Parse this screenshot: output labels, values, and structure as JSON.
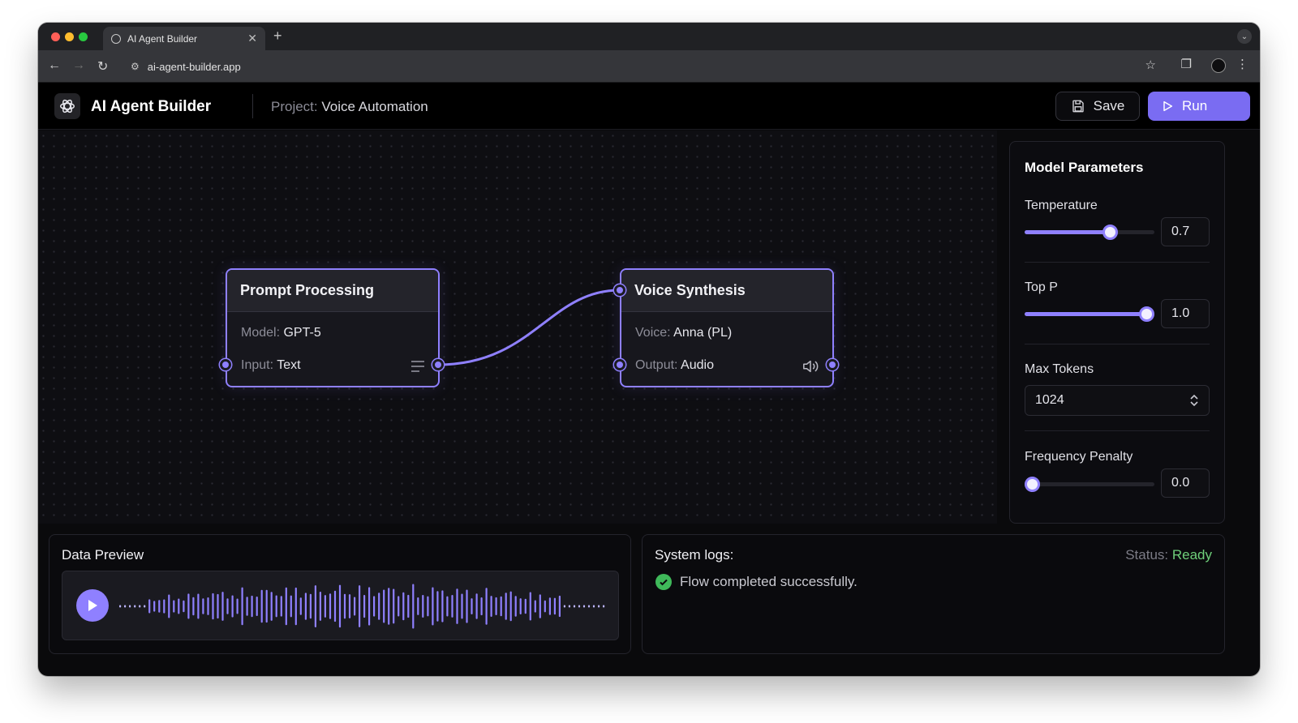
{
  "browser": {
    "tab_title": "AI Agent Builder",
    "url": "ai-agent-builder.app"
  },
  "header": {
    "app_title": "AI Agent Builder",
    "project_label": "Project:",
    "project_name": "Voice Automation",
    "save_label": "Save",
    "run_label": "Run"
  },
  "nodes": [
    {
      "title": "Prompt Processing",
      "rows": [
        {
          "label": "Model:",
          "value": "GPT-5"
        },
        {
          "label": "Input:",
          "value": "Text"
        }
      ],
      "icon": "list-icon"
    },
    {
      "title": "Voice Synthesis",
      "rows": [
        {
          "label": "Voice:",
          "value": "Anna (PL)"
        },
        {
          "label": "Output:",
          "value": "Audio"
        }
      ],
      "icon": "speaker-icon"
    }
  ],
  "params": {
    "title": "Model Parameters",
    "temperature": {
      "label": "Temperature",
      "value": "0.7",
      "level": 0.7
    },
    "top_p": {
      "label": "Top P",
      "value": "1.0",
      "level": 1.0
    },
    "max_tokens": {
      "label": "Max Tokens",
      "value": "1024"
    },
    "frequency_penalty": {
      "label": "Frequency Penalty",
      "value": "0.0",
      "level": 0.0
    }
  },
  "preview": {
    "title": "Data Preview"
  },
  "logs": {
    "title": "System logs:",
    "status_label": "Status:",
    "status_value": "Ready",
    "message": "Flow completed successfully."
  },
  "colors": {
    "accent": "#8f80ff",
    "run_button": "#7a6cf2",
    "status_ready": "#6fcf7a",
    "success": "#3fb95a"
  }
}
